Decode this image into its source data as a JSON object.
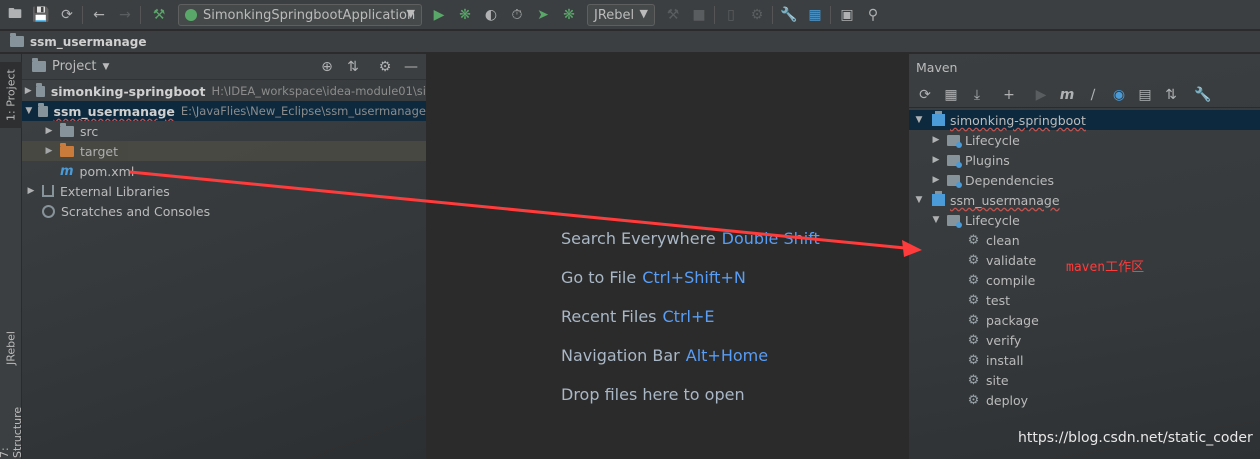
{
  "toolbar": {
    "run_config": "SimonkingSpringbootApplication",
    "jrebel": "JRebel"
  },
  "breadcrumb": {
    "label": "ssm_usermanage"
  },
  "left_strip": {
    "project_tab": "1: Project",
    "jrebel_tab": "JRebel",
    "structure_tab": "7: Structure"
  },
  "project_panel": {
    "title": "Project",
    "tree": [
      {
        "name": "simonking-springboot",
        "path": "H:\\IDEA_workspace\\idea-module01\\si"
      },
      {
        "name": "ssm_usermanage",
        "path": "E:\\JavaFlies\\New_Eclipse\\ssm_usermanage"
      },
      {
        "name": "src"
      },
      {
        "name": "target"
      },
      {
        "name": "pom.xml",
        "icon_letter": "m"
      },
      {
        "name": "External Libraries"
      },
      {
        "name": "Scratches and Consoles"
      }
    ]
  },
  "editor": {
    "hints": [
      {
        "label": "Search Everywhere",
        "key": "Double Shift"
      },
      {
        "label": "Go to File",
        "key": "Ctrl+Shift+N"
      },
      {
        "label": "Recent Files",
        "key": "Ctrl+E"
      },
      {
        "label": "Navigation Bar",
        "key": "Alt+Home"
      },
      {
        "label": "Drop files here to open",
        "key": ""
      }
    ]
  },
  "maven": {
    "title": "Maven",
    "tool_m": "m",
    "projects": [
      {
        "name": "simonking-springboot",
        "children": [
          "Lifecycle",
          "Plugins",
          "Dependencies"
        ]
      },
      {
        "name": "ssm_usermanage",
        "lifecycle": "Lifecycle",
        "phases": [
          "clean",
          "validate",
          "compile",
          "test",
          "package",
          "verify",
          "install",
          "site",
          "deploy"
        ]
      }
    ]
  },
  "annotation": "maven工作区",
  "watermark": "https://blog.csdn.net/static_coder",
  "colors": {
    "accent_blue": "#589df6",
    "selection": "#0d293e",
    "annotation_red": "#ff3b3b",
    "run_green": "#59a869"
  }
}
